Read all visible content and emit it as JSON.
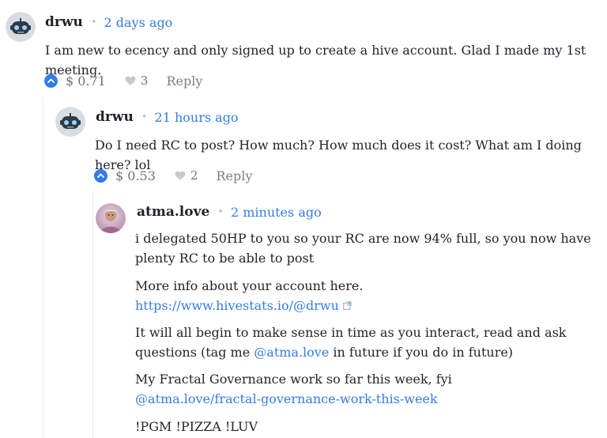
{
  "comments": [
    {
      "author": "drwu",
      "time": "2 days ago",
      "text": "I am new to ecency and only signed up to create a hive account. Glad I made my 1st meeting.",
      "payout": "$ 0.71",
      "votes": "3",
      "reply_label": "Reply"
    },
    {
      "author": "drwu",
      "time": "21 hours ago",
      "text": "Do I need RC to post? How much? How much does it cost? What am I doing here? lol",
      "payout": "$ 0.53",
      "votes": "2",
      "reply_label": "Reply"
    },
    {
      "author": "atma.love",
      "time": "2 minutes ago",
      "p1": "i delegated 50HP to you so your RC are now 94% full, so you now have plenty RC to be able to post",
      "p2_text": "More info about your account here.",
      "p2_link": "https://www.hivestats.io/@drwu",
      "p3_before": "It will all begin to make sense in time as you interact, read and ask questions (tag me ",
      "p3_mention": "@atma.love",
      "p3_after": " in future if you do in future)",
      "p4_text": "My Fractal Governance work so far this week, fyi",
      "p4_link": "@atma.love/fractal-governance-work-this-week",
      "p5": "!PGM !PIZZA !LUV"
    }
  ],
  "colors": {
    "accent": "#357ce6",
    "text": "#212529",
    "muted": "#6c757d"
  },
  "icons": [
    "robot-avatar",
    "upvote-chevron-icon",
    "heart-icon",
    "external-link-icon"
  ]
}
